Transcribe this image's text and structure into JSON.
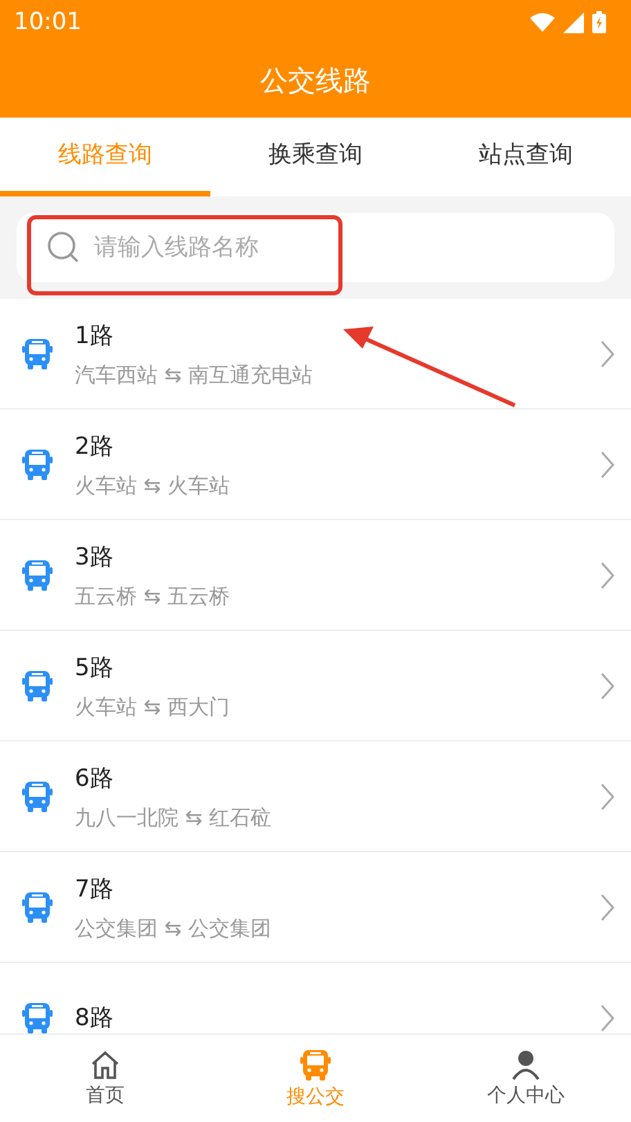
{
  "status_bar": {
    "time": "10:01"
  },
  "title": "公交线路",
  "tabs": [
    {
      "label": "线路查询",
      "selected": true
    },
    {
      "label": "换乘查询",
      "selected": false
    },
    {
      "label": "站点查询",
      "selected": false
    }
  ],
  "search": {
    "placeholder": "请输入线路名称"
  },
  "routes": [
    {
      "name": "1路",
      "stops": "汽车西站 ⇆ 南互通充电站"
    },
    {
      "name": "2路",
      "stops": "火车站 ⇆ 火车站"
    },
    {
      "name": "3路",
      "stops": "五云桥 ⇆ 五云桥"
    },
    {
      "name": "5路",
      "stops": "火车站 ⇆ 西大门"
    },
    {
      "name": "6路",
      "stops": "九八一北院 ⇆ 红石砬"
    },
    {
      "name": "7路",
      "stops": "公交集团 ⇆ 公交集团"
    },
    {
      "name": "8路"
    }
  ],
  "nav": [
    {
      "label": "首页",
      "kind": "home",
      "selected": false
    },
    {
      "label": "搜公交",
      "kind": "bus",
      "selected": true
    },
    {
      "label": "个人中心",
      "kind": "person",
      "selected": false
    }
  ]
}
